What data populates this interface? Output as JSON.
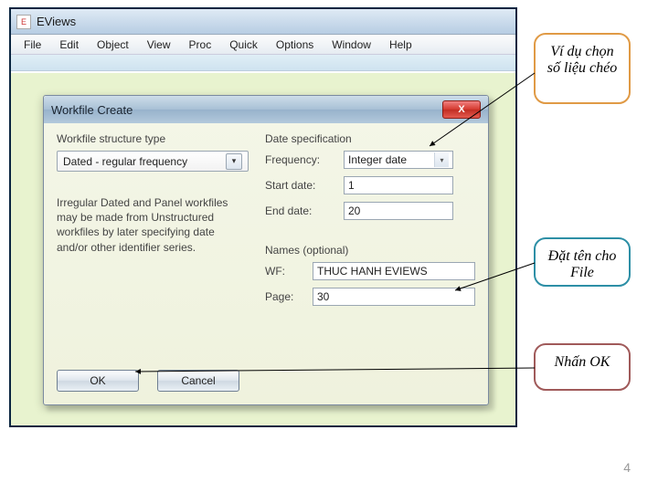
{
  "app": {
    "title": "EViews",
    "icon_label": "E"
  },
  "menubar": [
    "File",
    "Edit",
    "Object",
    "View",
    "Proc",
    "Quick",
    "Options",
    "Window",
    "Help"
  ],
  "dialog": {
    "title": "Workfile Create",
    "close_label": "X",
    "left": {
      "group_label": "Workfile structure type",
      "combo_value": "Dated - regular frequency",
      "hint": "Irregular Dated and Panel workfiles may be made from Unstructured workfiles by later specifying date and/or other identifier series."
    },
    "right": {
      "date_group_label": "Date specification",
      "freq_label": "Frequency:",
      "freq_value": "Integer date",
      "start_label": "Start date:",
      "start_value": "1",
      "end_label": "End date:",
      "end_value": "20",
      "names_group_label": "Names (optional)",
      "wf_label": "WF:",
      "wf_value": "THUC HANH EVIEWS",
      "page_label": "Page:",
      "page_value": "30"
    },
    "buttons": {
      "ok": "OK",
      "cancel": "Cancel"
    }
  },
  "annotations": {
    "c1": "Ví dụ chọn số liệu chéo",
    "c2": "Đặt tên cho File",
    "c3": "Nhấn OK"
  },
  "page_number": "4"
}
